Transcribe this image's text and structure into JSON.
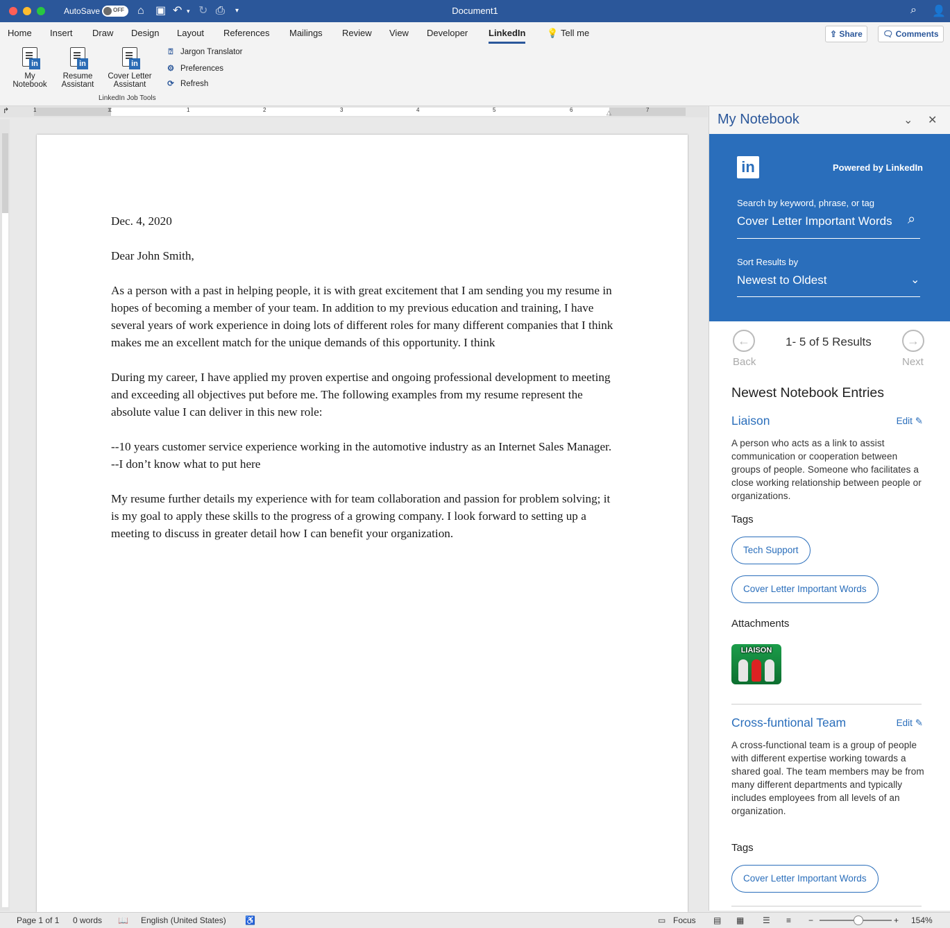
{
  "titlebar": {
    "autosave_label": "AutoSave",
    "toggle_state": "OFF",
    "document_title": "Document1"
  },
  "tabs": [
    "Home",
    "Insert",
    "Draw",
    "Design",
    "Layout",
    "References",
    "Mailings",
    "Review",
    "View",
    "Developer",
    "LinkedIn"
  ],
  "tell_me": "Tell me",
  "share_label": "Share",
  "comments_label": "Comments",
  "ribbon": {
    "my_notebook": [
      "My",
      "Notebook"
    ],
    "resume_assistant": [
      "Resume",
      "Assistant"
    ],
    "cover_letter_assistant": [
      "Cover Letter",
      "Assistant"
    ],
    "jargon_translator": "Jargon Translator",
    "preferences": "Preferences",
    "refresh": "Refresh",
    "group_label": "LinkedIn Job Tools"
  },
  "document": {
    "paragraphs": [
      "Dec. 4, 2020",
      "Dear John Smith,",
      "As a person with a past in helping people, it is with great excitement that I am sending you my resume in hopes of becoming a member of your team. In addition to my previous education and training, I have several years of work experience in doing lots of different roles for many different companies that I think makes me an excellent match for the unique demands of this opportunity. I think",
      "During my career, I have applied my proven expertise and ongoing professional development to meeting and exceeding all objectives put before me. The following examples from my resume represent the absolute value I can deliver in this new role:",
      "--10 years customer service experience working in the automotive industry as an Internet Sales Manager.",
      "--I don’t know what to put here",
      "My resume further details my experience with for team collaboration and passion for problem solving; it is my goal to apply these skills to the progress of a growing company. I look forward to setting up a meeting to discuss in greater detail how I can benefit your organization."
    ]
  },
  "pane": {
    "title": "My Notebook",
    "powered_by": "Powered by LinkedIn",
    "search_label": "Search by keyword, phrase, or tag",
    "search_value": "Cover Letter Important Words",
    "sort_label": "Sort Results by",
    "sort_value": "Newest to Oldest",
    "back_label": "Back",
    "next_label": "Next",
    "results_text": "1- 5 of 5 Results",
    "section_title": "Newest Notebook Entries",
    "edit_label": "Edit",
    "tags_label": "Tags",
    "attachments_label": "Attachments",
    "entries": [
      {
        "title": "Liaison",
        "description": "A person who acts as a link to assist communication or cooperation between groups of people. Someone who facilitates a close working relationship between people or organizations.",
        "tags": [
          "Tech Support",
          "Cover Letter Important Words"
        ],
        "attachment_text": "LIAISON"
      },
      {
        "title": "Cross-funtional Team",
        "description": "A cross-functional team is a group of people with different expertise working towards a shared goal. The team members may be from many different departments and typically includes employees from all levels of an organization.",
        "tags": [
          "Cover Letter Important Words"
        ]
      }
    ]
  },
  "status": {
    "page": "Page 1 of 1",
    "words": "0 words",
    "language": "English (United States)",
    "focus": "Focus",
    "zoom": "154%"
  },
  "ruler_numbers": [
    "1",
    "1",
    "2",
    "3",
    "4",
    "5",
    "6",
    "7"
  ],
  "colors": {
    "word_blue": "#2b579a",
    "linkedin_blue": "#2a6ebb"
  }
}
